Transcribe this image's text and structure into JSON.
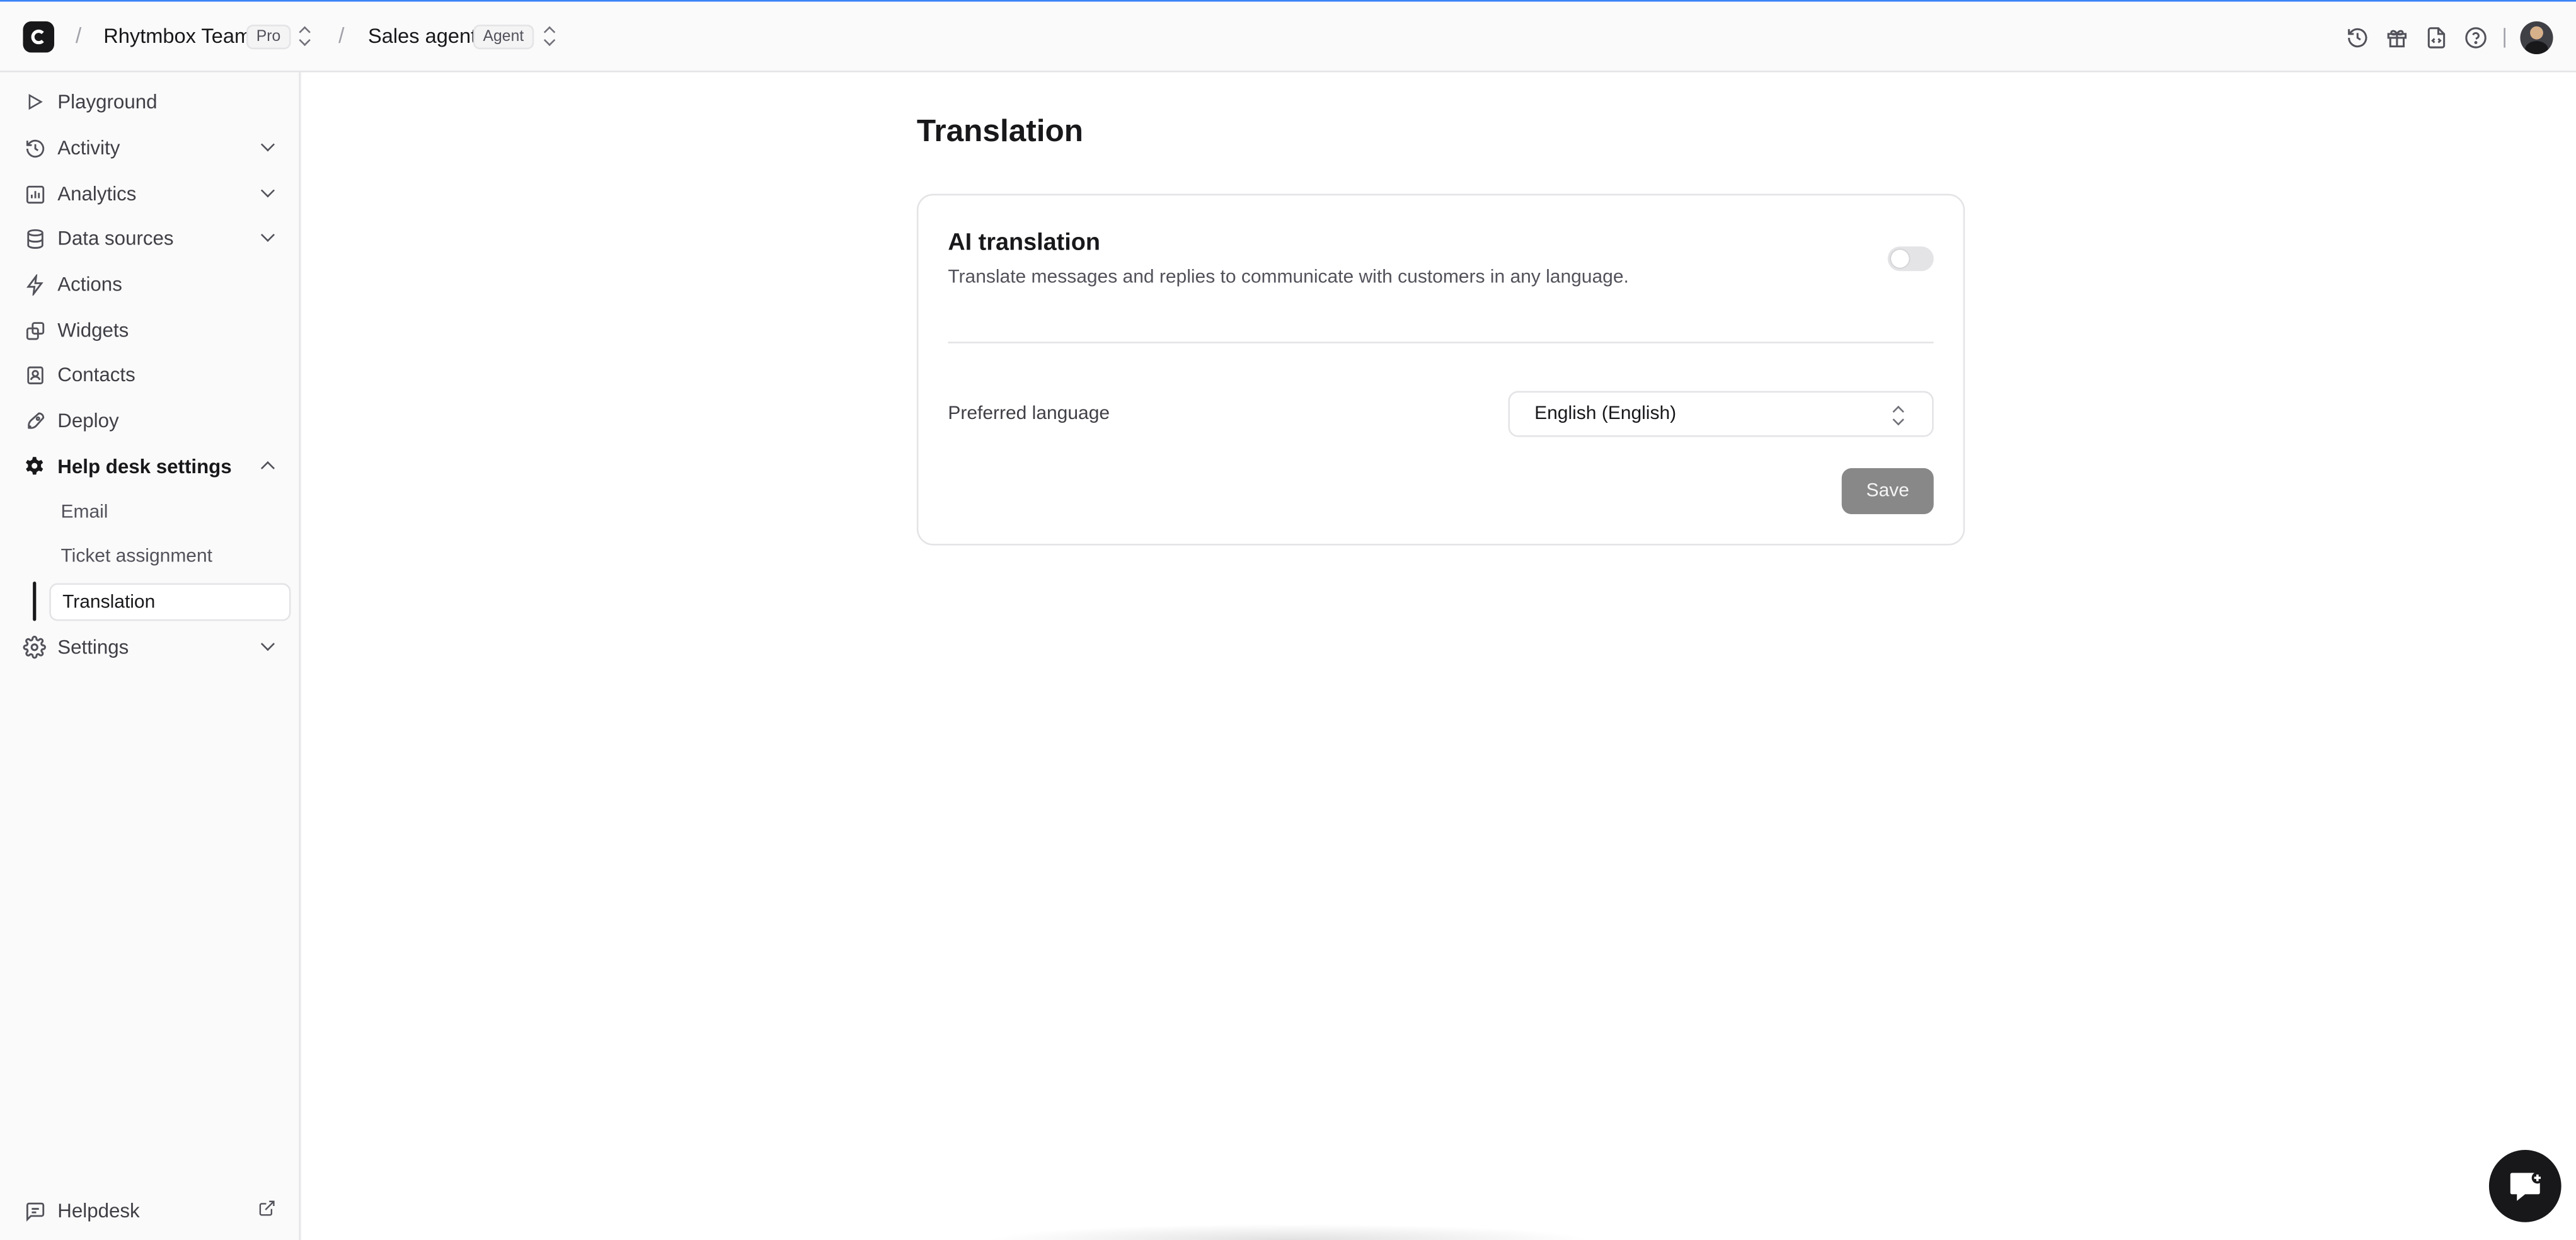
{
  "topbar": {
    "team_name": "Rhytmbox Team",
    "team_plan": "Pro",
    "agent_name": "Sales agent",
    "agent_type": "Agent",
    "icons": [
      "history-icon",
      "gift-icon",
      "code-file-icon",
      "help-icon",
      "avatar"
    ]
  },
  "sidebar": {
    "items": [
      {
        "label": "Playground",
        "icon": "play-icon"
      },
      {
        "label": "Activity",
        "icon": "history-icon"
      },
      {
        "label": "Analytics",
        "icon": "bar-chart-icon"
      },
      {
        "label": "Data sources",
        "icon": "database-icon"
      },
      {
        "label": "Actions",
        "icon": "bolt-icon"
      },
      {
        "label": "Widgets",
        "icon": "widgets-icon"
      },
      {
        "label": "Contacts",
        "icon": "contacts-icon"
      },
      {
        "label": "Deploy",
        "icon": "rocket-icon"
      },
      {
        "label": "Help desk settings",
        "icon": "gear-icon"
      },
      {
        "label": "Settings",
        "icon": "settings-icon"
      }
    ],
    "help_desk_sub": [
      "Email",
      "Ticket assignment",
      "Translation"
    ],
    "footer_label": "Helpdesk"
  },
  "main": {
    "title": "Translation",
    "card": {
      "title": "AI translation",
      "description": "Translate messages and replies to communicate with customers in any language.",
      "toggle_on": false,
      "language_label": "Preferred language",
      "language_value": "English (English)",
      "save_label": "Save"
    }
  },
  "colors": {
    "accent": "#18181b",
    "save_disabled": "#888888",
    "border": "#e4e4e7"
  }
}
